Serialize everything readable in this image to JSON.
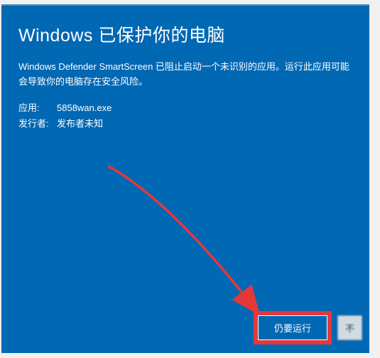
{
  "dialog": {
    "title": "Windows 已保护你的电脑",
    "warning": "Windows Defender SmartScreen 已阻止启动一个未识别的应用。运行此应用可能会导致你的电脑存在安全风险。",
    "app_label": "应用:",
    "app_value": "5858wan.exe",
    "publisher_label": "发行者:",
    "publisher_value": "发布者未知",
    "run_anyway": "仍要运行",
    "dont_run_partial": "不"
  }
}
